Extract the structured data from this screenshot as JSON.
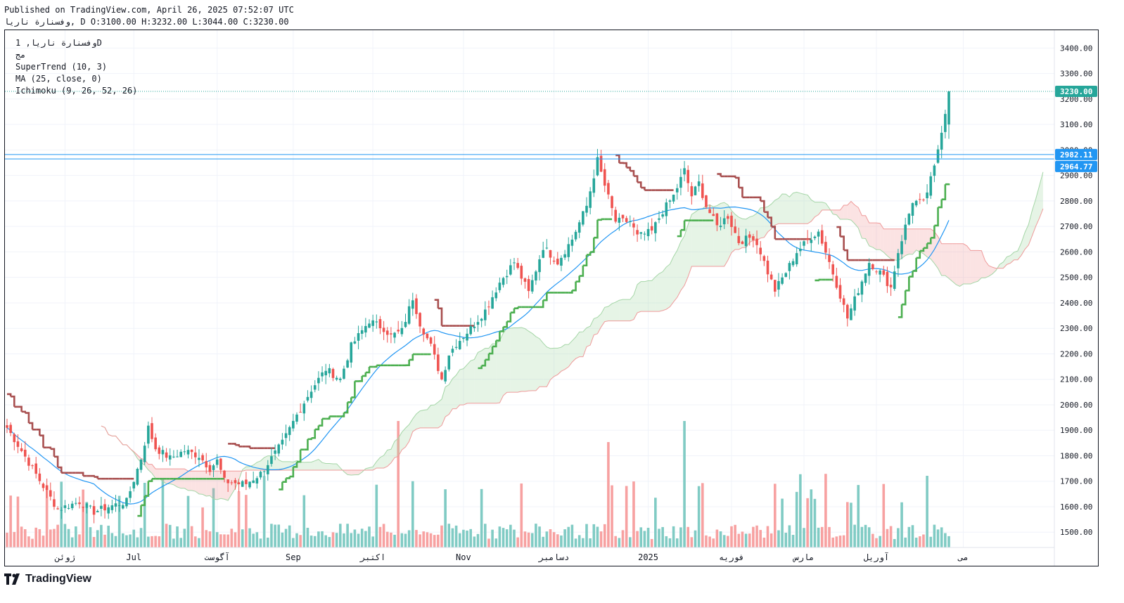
{
  "header": {
    "published": "Published on TradingView.com, April 26, 2025 07:52:07 UTC",
    "ohlc": "وفسنارة ناريا, D O:3100.00 H:3232.00 L:3044.00 C:3230.00"
  },
  "legend": {
    "symbol": "وفسنارة ناريا, 1D",
    "exchange": "مج",
    "supertrend": "SuperTrend (10, 3)",
    "ma": "MA (25, close, 0)",
    "ichimoku": "Ichimoku (9, 26, 52, 26)"
  },
  "logo": {
    "text": "TradingView",
    "icon": "tradingview-logo-icon"
  },
  "chart_data": {
    "type": "candlestick",
    "title": "",
    "xlabel": "",
    "ylabel": "",
    "ylim": [
      1400,
      3450
    ],
    "y_ticks": [
      1500,
      1600,
      1700,
      1800,
      1900,
      2000,
      2100,
      2200,
      2300,
      2400,
      2500,
      2600,
      2700,
      2800,
      2900,
      3000,
      3100,
      3200,
      3300,
      3400
    ],
    "y_tick_labels": [
      "1500.00",
      "1600.00",
      "1700.00",
      "1800.00",
      "1900.00",
      "2000.00",
      "2100.00",
      "2200.00",
      "2300.00",
      "2400.00",
      "2500.00",
      "2600.00",
      "2700.00",
      "2800.00",
      "2900.00",
      "3000.00",
      "3100.00",
      "3200.00",
      "3300.00",
      "3400.00"
    ],
    "x_ticks": [
      {
        "label": "ژوئن",
        "idx": 16
      },
      {
        "label": "Jul",
        "idx": 35
      },
      {
        "label": "آگوست",
        "idx": 58
      },
      {
        "label": "Sep",
        "idx": 79
      },
      {
        "label": "اکتبر",
        "idx": 101
      },
      {
        "label": "Nov",
        "idx": 126
      },
      {
        "label": "دسامبر",
        "idx": 151
      },
      {
        "label": "2025",
        "idx": 177
      },
      {
        "label": "فوریه",
        "idx": 200
      },
      {
        "label": "مارس",
        "idx": 220
      },
      {
        "label": "آوریل",
        "idx": 240
      },
      {
        "label": "می",
        "idx": 264
      }
    ],
    "price_labels": [
      {
        "label": "3230.00",
        "value": 3230,
        "color": "#26a69a"
      },
      {
        "label": "2982.11",
        "value": 2982.11,
        "color": "#2196f3"
      },
      {
        "label": "2964.77",
        "value": 2964.77,
        "color": "#2196f3"
      }
    ],
    "hlines": [
      2982.11,
      2964.77
    ],
    "last_close": 3230,
    "colors": {
      "up": "#26a69a",
      "down": "#ef5350",
      "supertrend_up": "#4caf50",
      "supertrend_down": "#a84f4f",
      "ma": "#2196f3",
      "kumo_bull": "#a5d6a7",
      "kumo_bear": "#ef9a9a",
      "vol_up": "#80cbc4",
      "vol_down": "#f7a1a1"
    },
    "anchors": [
      [
        0,
        1910
      ],
      [
        4,
        1820
      ],
      [
        10,
        1680
      ],
      [
        14,
        1590
      ],
      [
        20,
        1620
      ],
      [
        24,
        1580
      ],
      [
        28,
        1600
      ],
      [
        33,
        1620
      ],
      [
        37,
        1790
      ],
      [
        39,
        1910
      ],
      [
        41,
        1830
      ],
      [
        45,
        1790
      ],
      [
        49,
        1820
      ],
      [
        53,
        1800
      ],
      [
        56,
        1750
      ],
      [
        58,
        1780
      ],
      [
        60,
        1700
      ],
      [
        64,
        1690
      ],
      [
        66,
        1690
      ],
      [
        70,
        1730
      ],
      [
        73,
        1790
      ],
      [
        76,
        1850
      ],
      [
        80,
        1960
      ],
      [
        84,
        2060
      ],
      [
        88,
        2140
      ],
      [
        92,
        2100
      ],
      [
        95,
        2230
      ],
      [
        98,
        2290
      ],
      [
        100,
        2330
      ],
      [
        104,
        2300
      ],
      [
        106,
        2270
      ],
      [
        109,
        2290
      ],
      [
        112,
        2420
      ],
      [
        114,
        2320
      ],
      [
        117,
        2230
      ],
      [
        120,
        2100
      ],
      [
        122,
        2200
      ],
      [
        124,
        2240
      ],
      [
        128,
        2300
      ],
      [
        132,
        2370
      ],
      [
        136,
        2480
      ],
      [
        140,
        2560
      ],
      [
        144,
        2440
      ],
      [
        148,
        2620
      ],
      [
        152,
        2560
      ],
      [
        156,
        2650
      ],
      [
        160,
        2780
      ],
      [
        163,
        2960
      ],
      [
        165,
        2860
      ],
      [
        168,
        2720
      ],
      [
        172,
        2720
      ],
      [
        174,
        2660
      ],
      [
        178,
        2680
      ],
      [
        181,
        2760
      ],
      [
        184,
        2820
      ],
      [
        187,
        2920
      ],
      [
        189,
        2820
      ],
      [
        191,
        2870
      ],
      [
        193,
        2780
      ],
      [
        196,
        2700
      ],
      [
        199,
        2740
      ],
      [
        202,
        2640
      ],
      [
        206,
        2660
      ],
      [
        208,
        2600
      ],
      [
        210,
        2520
      ],
      [
        212,
        2450
      ],
      [
        215,
        2520
      ],
      [
        218,
        2600
      ],
      [
        222,
        2660
      ],
      [
        224,
        2680
      ],
      [
        227,
        2560
      ],
      [
        230,
        2430
      ],
      [
        232,
        2340
      ],
      [
        235,
        2450
      ],
      [
        238,
        2560
      ],
      [
        241,
        2520
      ],
      [
        244,
        2460
      ],
      [
        246,
        2600
      ],
      [
        248,
        2700
      ],
      [
        250,
        2800
      ],
      [
        253,
        2790
      ],
      [
        256,
        2930
      ],
      [
        258,
        3080
      ],
      [
        259,
        3150
      ],
      [
        260,
        3230
      ]
    ]
  }
}
